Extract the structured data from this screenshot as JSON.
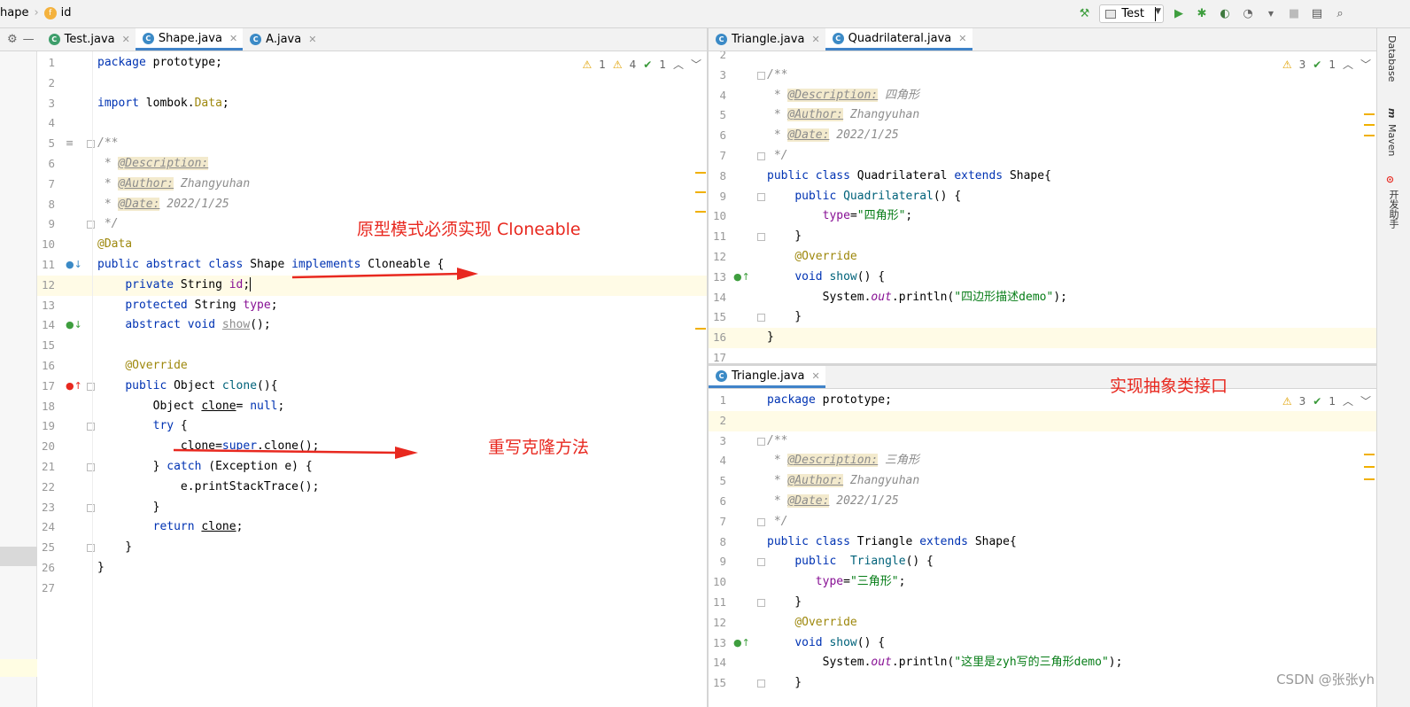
{
  "navbar": {
    "crumb1": "hape",
    "crumb2": "id",
    "run_config": "Test"
  },
  "left_tabs": [
    {
      "label": "Test.java",
      "active": false
    },
    {
      "label": "Shape.java",
      "active": true
    },
    {
      "label": "A.java",
      "active": false
    }
  ],
  "right_top_tabs": [
    {
      "label": "Triangle.java",
      "active": false
    },
    {
      "label": "Quadrilateral.java",
      "active": true
    }
  ],
  "right_bottom_tabs": [
    {
      "label": "Triangle.java",
      "active": true
    }
  ],
  "left_inspect": {
    "w1": "1",
    "w2": "4",
    "ok": "1"
  },
  "right_top_inspect": {
    "w": "3",
    "ok": "1"
  },
  "right_bottom_inspect": {
    "w": "3",
    "ok": "1"
  },
  "right_strip": {
    "database": "Database",
    "maven": "Maven",
    "dev_helper": "开发助手"
  },
  "shape_java": [
    {
      "n": "1",
      "html": "<span class='kw'>package</span> prototype;"
    },
    {
      "n": "2",
      "html": ""
    },
    {
      "n": "3",
      "html": "<span class='kw'>import</span> lombok.<span class='ann'>Data</span>;"
    },
    {
      "n": "4",
      "html": ""
    },
    {
      "n": "5",
      "html": "<span class='cm'>/**</span>"
    },
    {
      "n": "6",
      "html": "<span class='cm'> * </span><span class='tag'>@Description:</span>"
    },
    {
      "n": "7",
      "html": "<span class='cm'> * </span><span class='tag'>@Author:</span><span class='cm'> Zhangyuhan</span>"
    },
    {
      "n": "8",
      "html": "<span class='cm'> * </span><span class='tag'>@Date:</span><span class='cm'> 2022/1/25</span>"
    },
    {
      "n": "9",
      "html": "<span class='cm'> */</span>"
    },
    {
      "n": "10",
      "html": "<span class='ann'>@Data</span>"
    },
    {
      "n": "11",
      "html": "<span class='kw'>public abstract class</span> Shape <span class='kw'>implements</span> Cloneable {"
    },
    {
      "n": "12",
      "html": "    <span class='kw'>private</span> String <span class='fld'>id</span>;<span class='caret'></span>"
    },
    {
      "n": "13",
      "html": "    <span class='kw'>protected</span> String <span class='fld'>type</span>;"
    },
    {
      "n": "14",
      "html": "    <span class='kw'>abstract void</span> <span class='under' style='color:#8c8c8c'>show</span>();"
    },
    {
      "n": "15",
      "html": ""
    },
    {
      "n": "16",
      "html": "    <span class='ann'>@Override</span>"
    },
    {
      "n": "17",
      "html": "    <span class='kw'>public</span> Object <span style='color:#00627a'>clone</span>(){"
    },
    {
      "n": "18",
      "html": "        Object <span class='under'>clone</span>= <span class='kw'>null</span>;"
    },
    {
      "n": "19",
      "html": "        <span class='kw'>try</span> {"
    },
    {
      "n": "20",
      "html": "            <span class='under'>clone</span>=<span class='kw'>super</span>.clone();"
    },
    {
      "n": "21",
      "html": "        } <span class='kw'>catch</span> (Exception e) {"
    },
    {
      "n": "22",
      "html": "            e.printStackTrace();"
    },
    {
      "n": "23",
      "html": "        }"
    },
    {
      "n": "24",
      "html": "        <span class='kw'>return</span> <span class='under'>clone</span>;"
    },
    {
      "n": "25",
      "html": "    }"
    },
    {
      "n": "26",
      "html": "}"
    },
    {
      "n": "27",
      "html": ""
    }
  ],
  "quadrilateral_java": [
    {
      "n": "2",
      "html": ""
    },
    {
      "n": "3",
      "html": "<span class='cm'>/**</span>"
    },
    {
      "n": "4",
      "html": "<span class='cm'> * </span><span class='tag'>@Description:</span><span class='cm'> 四角形</span>"
    },
    {
      "n": "5",
      "html": "<span class='cm'> * </span><span class='tag'>@Author:</span><span class='cm'> Zhangyuhan</span>"
    },
    {
      "n": "6",
      "html": "<span class='cm'> * </span><span class='tag'>@Date:</span><span class='cm'> 2022/1/25</span>"
    },
    {
      "n": "7",
      "html": "<span class='cm'> */</span>"
    },
    {
      "n": "8",
      "html": "<span class='kw'>public class</span> Quadrilateral <span class='kw'>extends</span> Shape{"
    },
    {
      "n": "9",
      "html": "    <span class='kw'>public</span> <span style='color:#00627a'>Quadrilateral</span>() {"
    },
    {
      "n": "10",
      "html": "        <span class='fld'>type</span>=<span class='str'>\"四角形\"</span>;"
    },
    {
      "n": "11",
      "html": "    }"
    },
    {
      "n": "12",
      "html": "    <span class='ann'>@Override</span>"
    },
    {
      "n": "13",
      "html": "    <span class='kw'>void</span> <span style='color:#00627a'>show</span>() {"
    },
    {
      "n": "14",
      "html": "        System.<span class='ital'>out</span>.println(<span class='str'>\"四边形描述demo\"</span>);"
    },
    {
      "n": "15",
      "html": "    }"
    },
    {
      "n": "16",
      "html": "}"
    },
    {
      "n": "17",
      "html": ""
    }
  ],
  "triangle_java": [
    {
      "n": "1",
      "html": "<span class='kw'>package</span> prototype;"
    },
    {
      "n": "2",
      "html": ""
    },
    {
      "n": "3",
      "html": "<span class='cm'>/**</span>"
    },
    {
      "n": "4",
      "html": "<span class='cm'> * </span><span class='tag'>@Description:</span><span class='cm'> 三角形</span>"
    },
    {
      "n": "5",
      "html": "<span class='cm'> * </span><span class='tag'>@Author:</span><span class='cm'> Zhangyuhan</span>"
    },
    {
      "n": "6",
      "html": "<span class='cm'> * </span><span class='tag'>@Date:</span><span class='cm'> 2022/1/25</span>"
    },
    {
      "n": "7",
      "html": "<span class='cm'> */</span>"
    },
    {
      "n": "8",
      "html": "<span class='kw'>public class</span> Triangle <span class='kw'>extends</span> Shape{"
    },
    {
      "n": "9",
      "html": "    <span class='kw'>public</span>  <span style='color:#00627a'>Triangle</span>() {"
    },
    {
      "n": "10",
      "html": "       <span class='fld'>type</span>=<span class='str'>\"三角形\"</span>;"
    },
    {
      "n": "11",
      "html": "    }"
    },
    {
      "n": "12",
      "html": "    <span class='ann'>@Override</span>"
    },
    {
      "n": "13",
      "html": "    <span class='kw'>void</span> <span style='color:#00627a'>show</span>() {"
    },
    {
      "n": "14",
      "html": "        System.<span class='ital'>out</span>.println(<span class='str'>\"这里是zyh写的三角形demo\"</span>);"
    },
    {
      "n": "15",
      "html": "    }"
    }
  ],
  "annotations": {
    "cloneable_note": "原型模式必须实现 Cloneable",
    "override_note": "重写克隆方法",
    "abstract_note": "实现抽象类接口"
  },
  "watermark": "CSDN @张张yh"
}
